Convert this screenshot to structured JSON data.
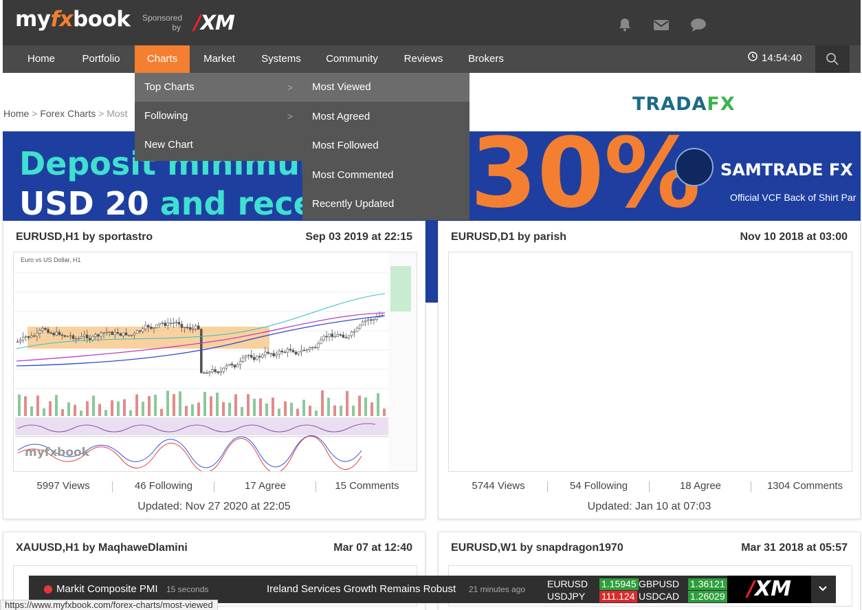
{
  "header": {
    "logo_left": "my",
    "logo_fx": "fx",
    "logo_right": "book",
    "sponsored": "Sponsored",
    "by": "by",
    "sponsor_brand": "XM"
  },
  "nav": {
    "items": [
      "Home",
      "Portfolio",
      "Charts",
      "Market",
      "Systems",
      "Community",
      "Reviews",
      "Brokers"
    ],
    "active": "Charts",
    "time": "14:54:40"
  },
  "dropdown": {
    "left": [
      "Top Charts",
      "Following",
      "New Chart"
    ],
    "right": [
      "Most Viewed",
      "Most Agreed",
      "Most Followed",
      "Most Commented",
      "Recently Updated"
    ]
  },
  "breadcrumb": {
    "home": "Home",
    "sep": ">",
    "forex_charts": "Forex Charts",
    "current": "Most"
  },
  "tradafx": {
    "part1": "TRADA",
    "part2": "FX"
  },
  "banner": {
    "line1": "Deposit minimum",
    "line2_a": "USD 20",
    "line2_b": " and rece",
    "big": "30%",
    "brand": "SAMTRADE FX",
    "tagline": "Official VCF Back of Shirt Par"
  },
  "cards": [
    {
      "title": "EURUSD,H1 by sportastro",
      "date": "Sep 03 2019 at 22:15",
      "views": "5997 Views",
      "following": "46 Following",
      "agree": "17 Agree",
      "comments": "15 Comments",
      "updated": "Updated: Nov 27 2020 at 22:05"
    },
    {
      "title": "EURUSD,D1 by parish",
      "date": "Nov 10 2018 at 03:00",
      "views": "5744 Views",
      "following": "54 Following",
      "agree": "18 Agree",
      "comments": "1304 Comments",
      "updated": "Updated: Jan 10 at 07:03"
    },
    {
      "title": "XAUUSD,H1 by MaqhaweDlamini",
      "date": "Mar 07 at 12:40"
    },
    {
      "title": "EURUSD,W1 by snapdragon1970",
      "date": "Mar 31 2018 at 05:57"
    }
  ],
  "chart_thumb": {
    "title": "Euro vs US Dollar, H1",
    "watermark": "myfxbook"
  },
  "ticker": {
    "headline1": "Markit Composite PMI",
    "time1": "15 seconds",
    "headline2": "Ireland Services Growth Remains Robust",
    "time2": "21 minutes ago",
    "quotes": [
      {
        "symbol": "EURUSD",
        "price": "1.15945",
        "dir": "up"
      },
      {
        "symbol": "GBPUSD",
        "price": "1.36121",
        "dir": "up"
      },
      {
        "symbol": "USDJPY",
        "price": "111.124",
        "dir": "down"
      },
      {
        "symbol": "USDCAD",
        "price": "1.26029",
        "dir": "up"
      }
    ],
    "brand": "XM"
  },
  "status_url": "https://www.myfxbook.com/forex-charts/most-viewed",
  "colors": {
    "accent": "#f47f30",
    "header_bg": "#3a3a3a",
    "nav_bg": "#4a4a4a",
    "banner_bg": "#1e3fa0",
    "price_up": "#2e9e3c",
    "price_down": "#d62c2c"
  },
  "icons": [
    "bell-icon",
    "mail-icon",
    "chat-icon",
    "clock-icon",
    "search-icon",
    "chevron-right-icon",
    "chevron-down-icon"
  ]
}
